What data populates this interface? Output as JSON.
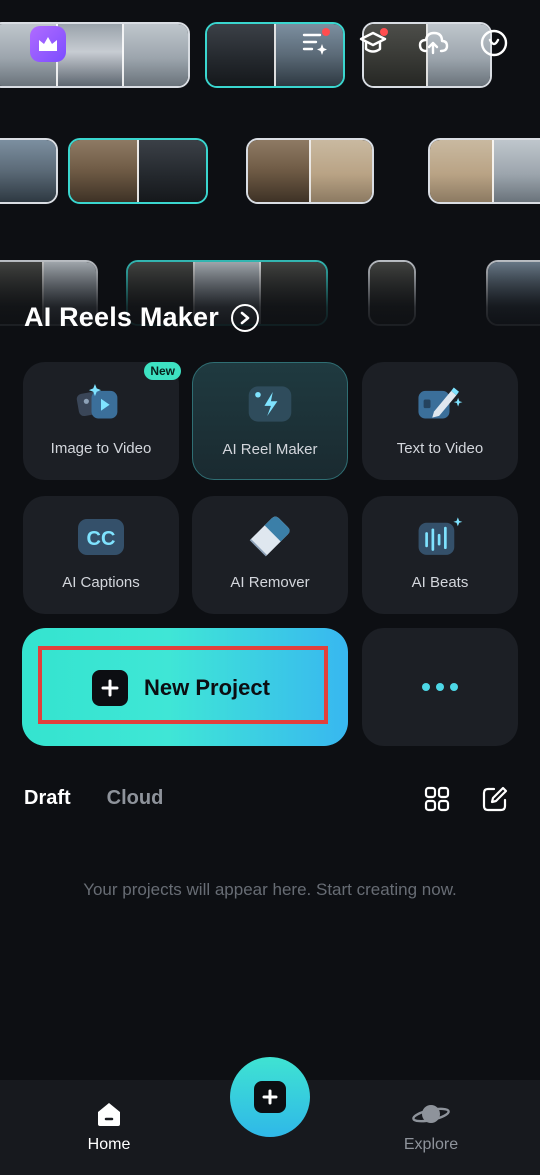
{
  "banner": {
    "title": "AI Reels Maker"
  },
  "tools": [
    {
      "label": "Image to Video",
      "badge": "New"
    },
    {
      "label": "AI Reel Maker"
    },
    {
      "label": "Text to Video"
    },
    {
      "label": "AI Captions",
      "icon_text": "CC"
    },
    {
      "label": "AI Remover"
    },
    {
      "label": "AI Beats"
    }
  ],
  "new_project": {
    "label": "New Project"
  },
  "drafts": {
    "tabs": [
      "Draft",
      "Cloud"
    ],
    "empty_message": "Your projects will appear here. Start creating now."
  },
  "bottom_nav": {
    "home_label": "Home",
    "explore_label": "Explore"
  },
  "colors": {
    "accent": "#3ad6cf",
    "background": "#0d0f13",
    "card": "#1c1f25",
    "highlight_border": "#e2403c"
  }
}
